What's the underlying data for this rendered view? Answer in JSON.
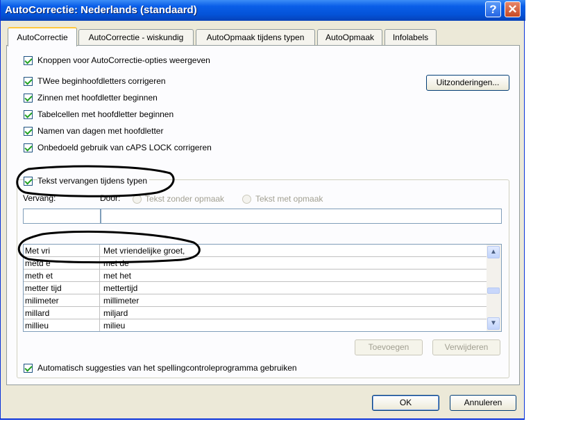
{
  "window": {
    "title": "AutoCorrectie: Nederlands (standaard)",
    "help_glyph": "?",
    "close_glyph": "✕"
  },
  "tabs": [
    "AutoCorrectie",
    "AutoCorrectie - wiskundig",
    "AutoOpmaak tijdens typen",
    "AutoOpmaak",
    "Infolabels"
  ],
  "options": {
    "show_buttons": "Knoppen voor AutoCorrectie-opties weergeven",
    "two_initial_caps": "TWee beginhoofdletters corrigeren",
    "sentences_caps": "Zinnen met hoofdletter beginnen",
    "table_cells_caps": "Tabelcellen met hoofdletter beginnen",
    "day_names_caps": "Namen van dagen met hoofdletter",
    "caps_lock": "Onbedoeld gebruik van cAPS LOCK corrigeren",
    "replace_text": "Tekst vervangen tijdens typen",
    "auto_suggest": "Automatisch suggesties van het spellingcontroleprogramma gebruiken"
  },
  "exceptions_button": "Uitzonderingen...",
  "replace": {
    "replace_label": "Vervang:",
    "with_label": "Door:",
    "plain_text": "Tekst zonder opmaak",
    "formatted_text": "Tekst met opmaak",
    "replace_value": "",
    "with_value": ""
  },
  "entries": [
    {
      "from": "Met vri",
      "to": "Met vriendelijke groet,"
    },
    {
      "from": "metd e",
      "to": "met de"
    },
    {
      "from": "meth et",
      "to": "met het"
    },
    {
      "from": "metter tijd",
      "to": "mettertijd"
    },
    {
      "from": "milimeter",
      "to": "millimeter"
    },
    {
      "from": "millard",
      "to": "miljard"
    },
    {
      "from": "millieu",
      "to": "milieu"
    }
  ],
  "buttons": {
    "add": "Toevoegen",
    "delete": "Verwijderen",
    "ok": "OK",
    "cancel": "Annuleren"
  },
  "scrollbar": {
    "up": "▲",
    "down": "▼"
  },
  "colors": {
    "titlebar": "#0453d8",
    "checkmark": "#21a121",
    "annotation": "#000000"
  }
}
